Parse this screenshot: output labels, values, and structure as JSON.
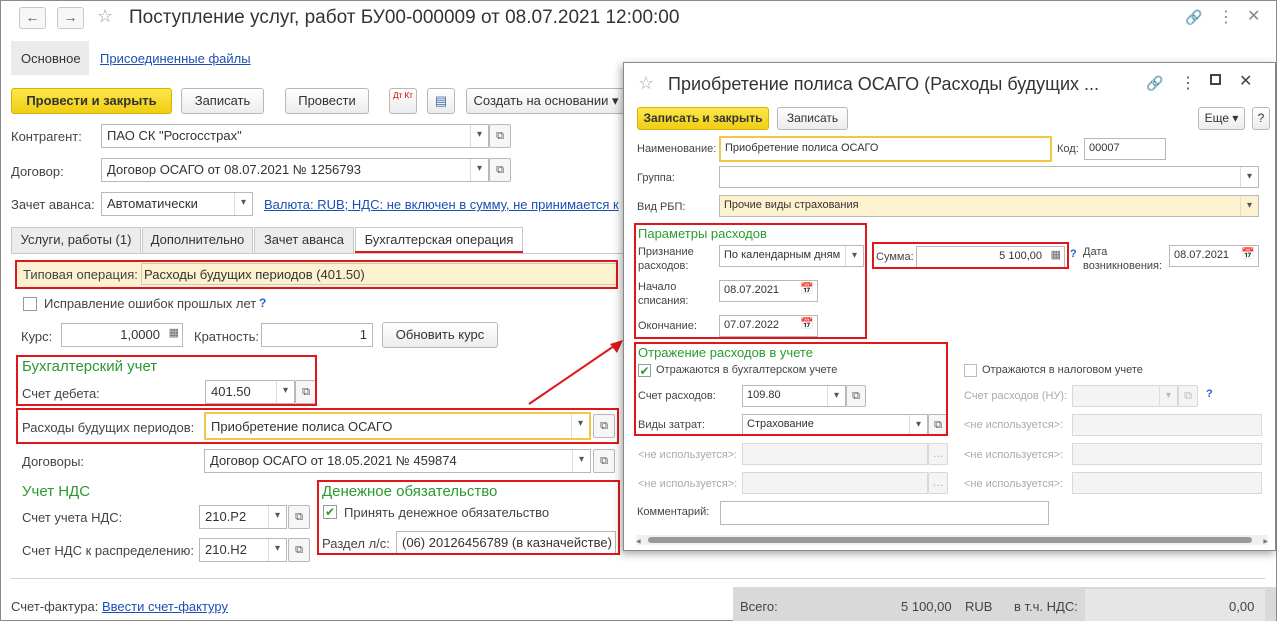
{
  "main": {
    "title": "Поступление услуг, работ БУ00-000009 от 08.07.2021 12:00:00",
    "nav_tabs": {
      "main": "Основное",
      "attached": "Присоединенные файлы"
    },
    "toolbar": {
      "post_close": "Провести и закрыть",
      "save": "Записать",
      "post": "Провести",
      "dt_kt": "Дт Кт",
      "create_based": "Создать на основании"
    },
    "counterparty_label": "Контрагент:",
    "counterparty_value": "ПАО СК \"Росгосстрах\"",
    "contract_label": "Договор:",
    "contract_value": "Договор ОСАГО от 08.07.2021 № 1256793",
    "advance_label": "Зачет аванса:",
    "advance_value": "Автоматически",
    "currency_link": "Валюта: RUB; НДС: не включен в сумму, не принимается к",
    "tabs": [
      "Услуги, работы (1)",
      "Дополнительно",
      "Зачет аванса",
      "Бухгалтерская операция"
    ],
    "typical_op_label": "Типовая операция:",
    "typical_op_value": "Расходы будущих периодов (401.50)",
    "fix_errors_label": "Исправление ошибок прошлых лет",
    "rate_label": "Курс:",
    "rate_value": "1,0000",
    "multiplicity_label": "Кратность:",
    "multiplicity_value": "1",
    "update_rate": "Обновить курс",
    "accounting_header": "Бухгалтерский учет",
    "debit_label": "Счет дебета:",
    "debit_value": "401.50",
    "deferred_label": "Расходы будущих периодов:",
    "deferred_value": "Приобретение полиса ОСАГО",
    "contracts_label": "Договоры:",
    "contracts_value": "Договор ОСАГО от 18.05.2021 № 459874",
    "vat_header": "Учет НДС",
    "vat_account_label": "Счет учета НДС:",
    "vat_account_value": "210.Р2",
    "vat_distr_label": "Счет НДС к распределению:",
    "vat_distr_value": "210.Н2",
    "money_header": "Денежное обязательство",
    "accept_money_label": "Принять денежное обязательство",
    "section_label": "Раздел л/с:",
    "section_value": "(06) 20126456789 (в казначействе)",
    "invoice_label": "Счет-фактура:",
    "invoice_link": "Ввести счет-фактуру",
    "total_label": "Всего:",
    "total_value": "5 100,00",
    "currency": "RUB",
    "vat_incl_label": "в т.ч. НДС:",
    "vat_value": "0,00"
  },
  "dialog": {
    "title": "Приобретение полиса ОСАГО (Расходы будущих ...",
    "save_close": "Записать и закрыть",
    "save": "Записать",
    "more": "Еще",
    "name_label": "Наименование:",
    "name_value": "Приобретение полиса ОСАГО",
    "code_label": "Код:",
    "code_value": "00007",
    "group_label": "Группа:",
    "group_value": "",
    "rbp_label": "Вид РБП:",
    "rbp_value": "Прочие виды страхования",
    "params_header": "Параметры расходов",
    "recognition_label_1": "Признание",
    "recognition_label_2": "расходов:",
    "recognition_value": "По календарным дням",
    "sum_label": "Сумма:",
    "sum_value": "5 100,00",
    "occurrence_label_1": "Дата",
    "occurrence_label_2": "возникновения:",
    "occurrence_value": "08.07.2021",
    "start_label_1": "Начало",
    "start_label_2": "списания:",
    "start_value": "08.07.2021",
    "end_label": "Окончание:",
    "end_value": "07.07.2022",
    "reflection_header": "Отражение расходов в учете",
    "in_accounting_label": "Отражаются в бухгалтерском учете",
    "in_tax_label": "Отражаются в налоговом учете",
    "expense_account_label": "Счет расходов:",
    "expense_account_value": "109.80",
    "expense_account_nu_label": "Счет расходов (НУ):",
    "cost_type_label": "Виды затрат:",
    "cost_type_value": "Страхование",
    "not_used": "<не используется>:",
    "comment_label": "Комментарий:"
  }
}
